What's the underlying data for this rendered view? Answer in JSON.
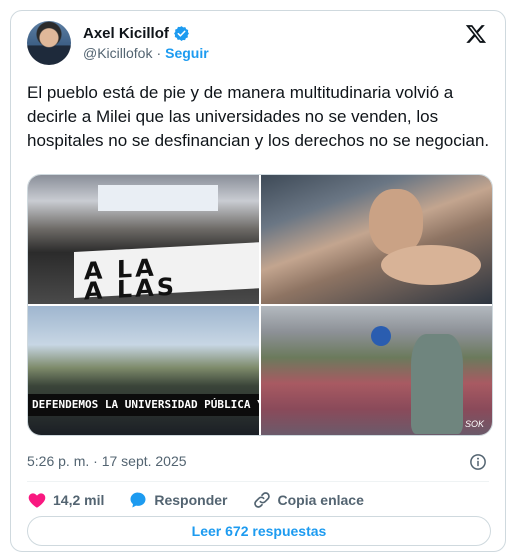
{
  "author": {
    "display_name": "Axel Kicillof",
    "handle": "@Kicillofok",
    "separator": "·",
    "follow_label": "Seguir",
    "verified_color": "#1d9bf0"
  },
  "tweet": {
    "text": "El pueblo está de pie y de manera multitudinaria volvió a decirle a Milei que las universidades no se venden, los hospitales no se desfinancian y los derechos no se negocian.",
    "timestamp": "5:26 p. m. · 17 sept. 2025"
  },
  "media": {
    "photo1_banner_text": "A LA\nA LAS",
    "photo3_banner_text": "DEFENDEMOS LA UNIVERSIDAD PÚBLICA Y LA CIENCIA",
    "photo4_watermark": "SOK"
  },
  "actions": {
    "like_count": "14,2 mil",
    "reply_label": "Responder",
    "copy_link_label": "Copia enlace"
  },
  "replies_button": {
    "label": "Leer 672 respuestas"
  },
  "colors": {
    "accent": "#1d9bf0",
    "like": "#f91880",
    "text": "#0f1419",
    "muted": "#536471",
    "border": "#cfd9de"
  },
  "icons": [
    "verified-badge-icon",
    "x-logo-icon",
    "info-icon",
    "heart-icon",
    "reply-bubble-icon",
    "link-icon"
  ]
}
